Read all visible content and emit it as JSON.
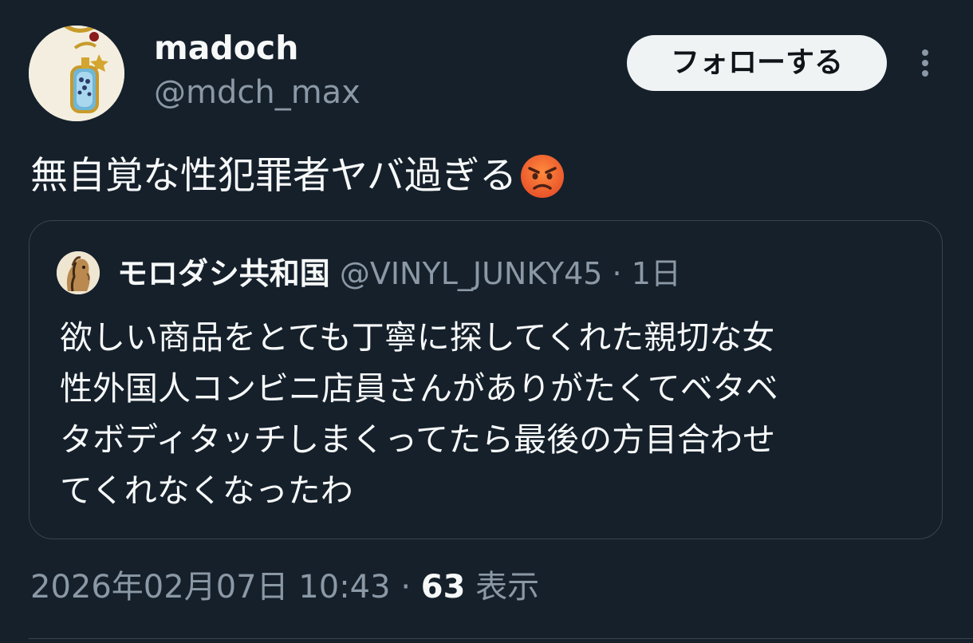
{
  "author": {
    "display_name": "madoch",
    "handle": "@mdch_max"
  },
  "follow_button_label": "フォローする",
  "more_icon": "more-vertical-icon",
  "tweet": {
    "text": "無自覚な性犯罪者ヤバ過ぎる",
    "emoji": "angry-face"
  },
  "quote": {
    "author_name": "モロダシ共和国",
    "author_handle": "@VINYL_JUNKY45",
    "separator": "·",
    "time": "1日",
    "lines": [
      "欲しい商品をとても丁寧に探してくれた親切な女",
      "性外国人コンビニ店員さんがありがたくてベタベ",
      "タボディタッチしまくってたら最後の方目合わせ",
      "てくれなくなったわ"
    ]
  },
  "meta": {
    "timestamp": "2026年02月07日 10:43",
    "separator": "·",
    "views_count": "63",
    "views_label": "表示"
  },
  "colors": {
    "background": "#15202b",
    "text_primary": "#f7f9f9",
    "text_secondary": "#8b98a5",
    "border": "#38444d",
    "follow_button_bg": "#eff3f4"
  }
}
